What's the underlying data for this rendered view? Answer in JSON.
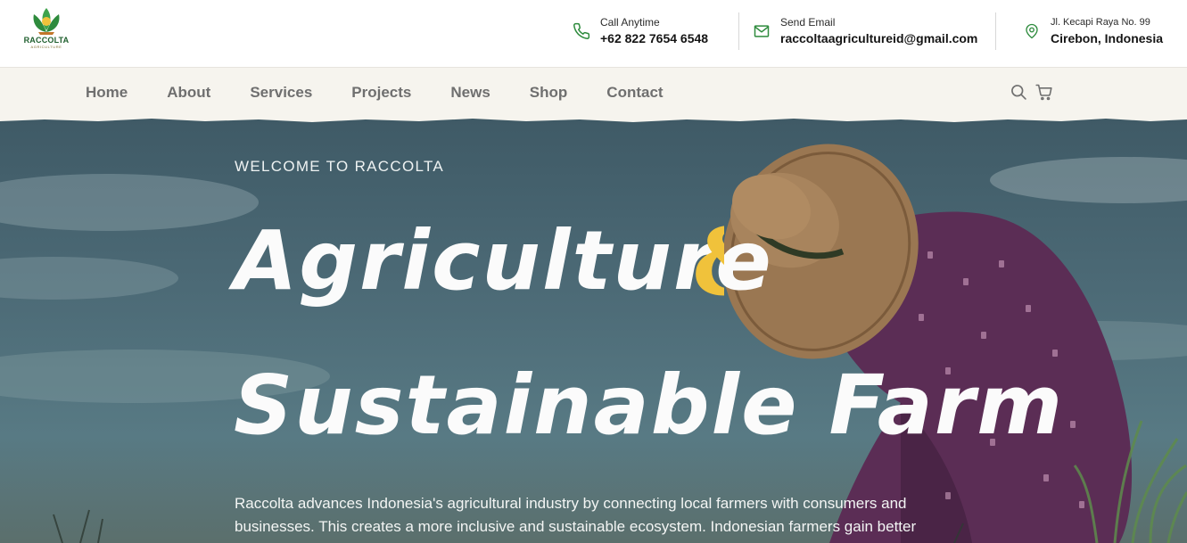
{
  "brand": {
    "name": "RACCOLTA",
    "tagline": "AGRICULTURE",
    "colors": {
      "primary_green": "#2e8b3d",
      "accent_yellow": "#f0c23b",
      "nav_bg": "#f6f4ee"
    }
  },
  "contacts": [
    {
      "icon": "phone-icon",
      "label": "Call Anytime",
      "value": "+62 822 7654 6548"
    },
    {
      "icon": "mail-icon",
      "label": "Send Email",
      "value": "raccoltaagricultureid@gmail.com"
    },
    {
      "icon": "location-pin-icon",
      "label": "Jl. Kecapi Raya No. 99",
      "value": "Cirebon, Indonesia"
    }
  ],
  "nav": {
    "items": [
      "Home",
      "About",
      "Services",
      "Projects",
      "News",
      "Shop",
      "Contact"
    ],
    "icons": [
      "search-icon",
      "cart-icon"
    ]
  },
  "hero": {
    "eyebrow": "WELCOME TO RACCOLTA",
    "title_line1": "Agriculture",
    "ampersand": "&",
    "title_line2": "Sustainable Farm",
    "description": "Raccolta advances Indonesia's agricultural industry by connecting local farmers with consumers and businesses. This creates a more inclusive and sustainable ecosystem. Indonesian farmers gain better access"
  }
}
